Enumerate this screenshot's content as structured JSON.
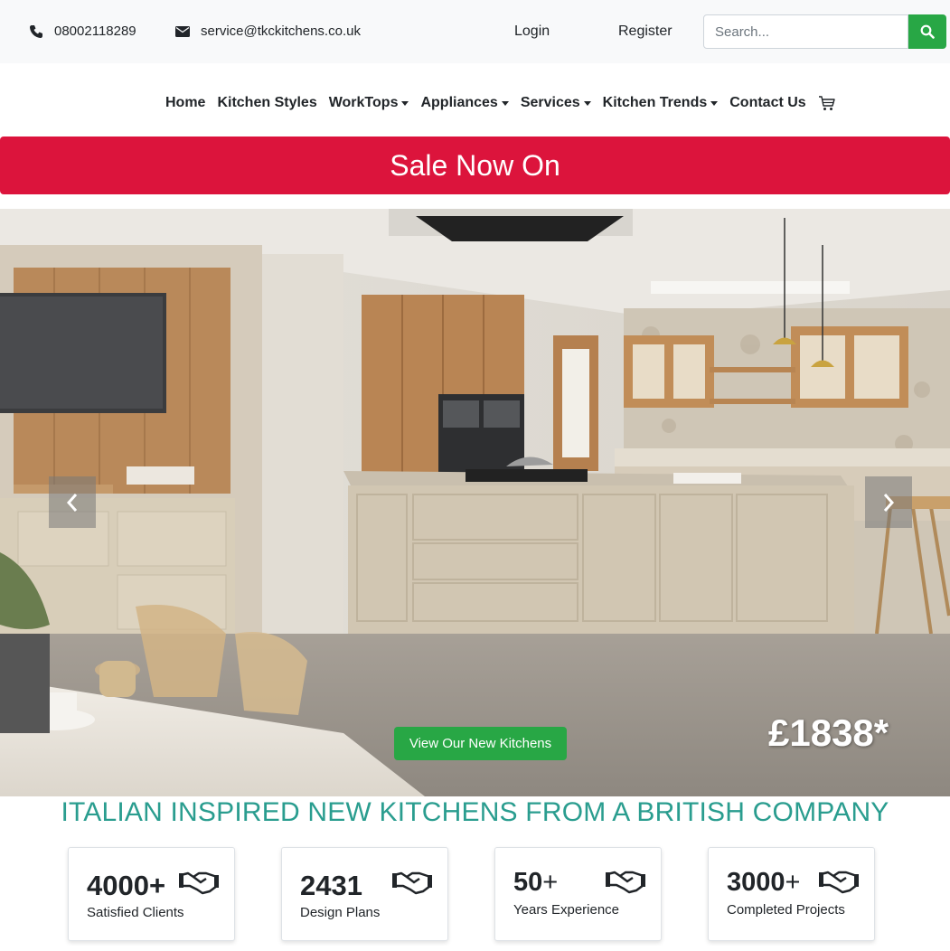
{
  "topbar": {
    "phone": "08002118289",
    "email": "service@tkckitchens.co.uk",
    "login_label": "Login",
    "register_label": "Register",
    "search_placeholder": "Search..."
  },
  "nav": {
    "home": "Home",
    "kitchen_styles": "Kitchen Styles",
    "worktops": "WorkTops",
    "appliances": "Appliances",
    "services": "Services",
    "kitchen_trends": "Kitchen Trends",
    "contact_us": "Contact Us"
  },
  "banner": {
    "text": "Sale Now On"
  },
  "hero": {
    "cta_label": "View Our New Kitchens",
    "price": "£1838*"
  },
  "headline": "ITALIAN INSPIRED NEW KITCHENS FROM A BRITISH COMPANY",
  "stats": [
    {
      "value": "4000",
      "suffix": "+",
      "label": "Satisfied Clients"
    },
    {
      "value": "2431",
      "suffix": "",
      "label": "Design Plans"
    },
    {
      "value": "50",
      "suffix": "+",
      "label": "Years Experience"
    },
    {
      "value": "3000",
      "suffix": "+",
      "label": "Completed Projects"
    }
  ],
  "colors": {
    "accent_green": "#28a745",
    "sale_red": "#dc143c",
    "headline_teal": "#2a9d8f"
  },
  "icons": [
    "phone-icon",
    "envelope-icon",
    "search-icon",
    "cart-icon",
    "chevron-left-icon",
    "chevron-right-icon",
    "handshake-icon"
  ]
}
